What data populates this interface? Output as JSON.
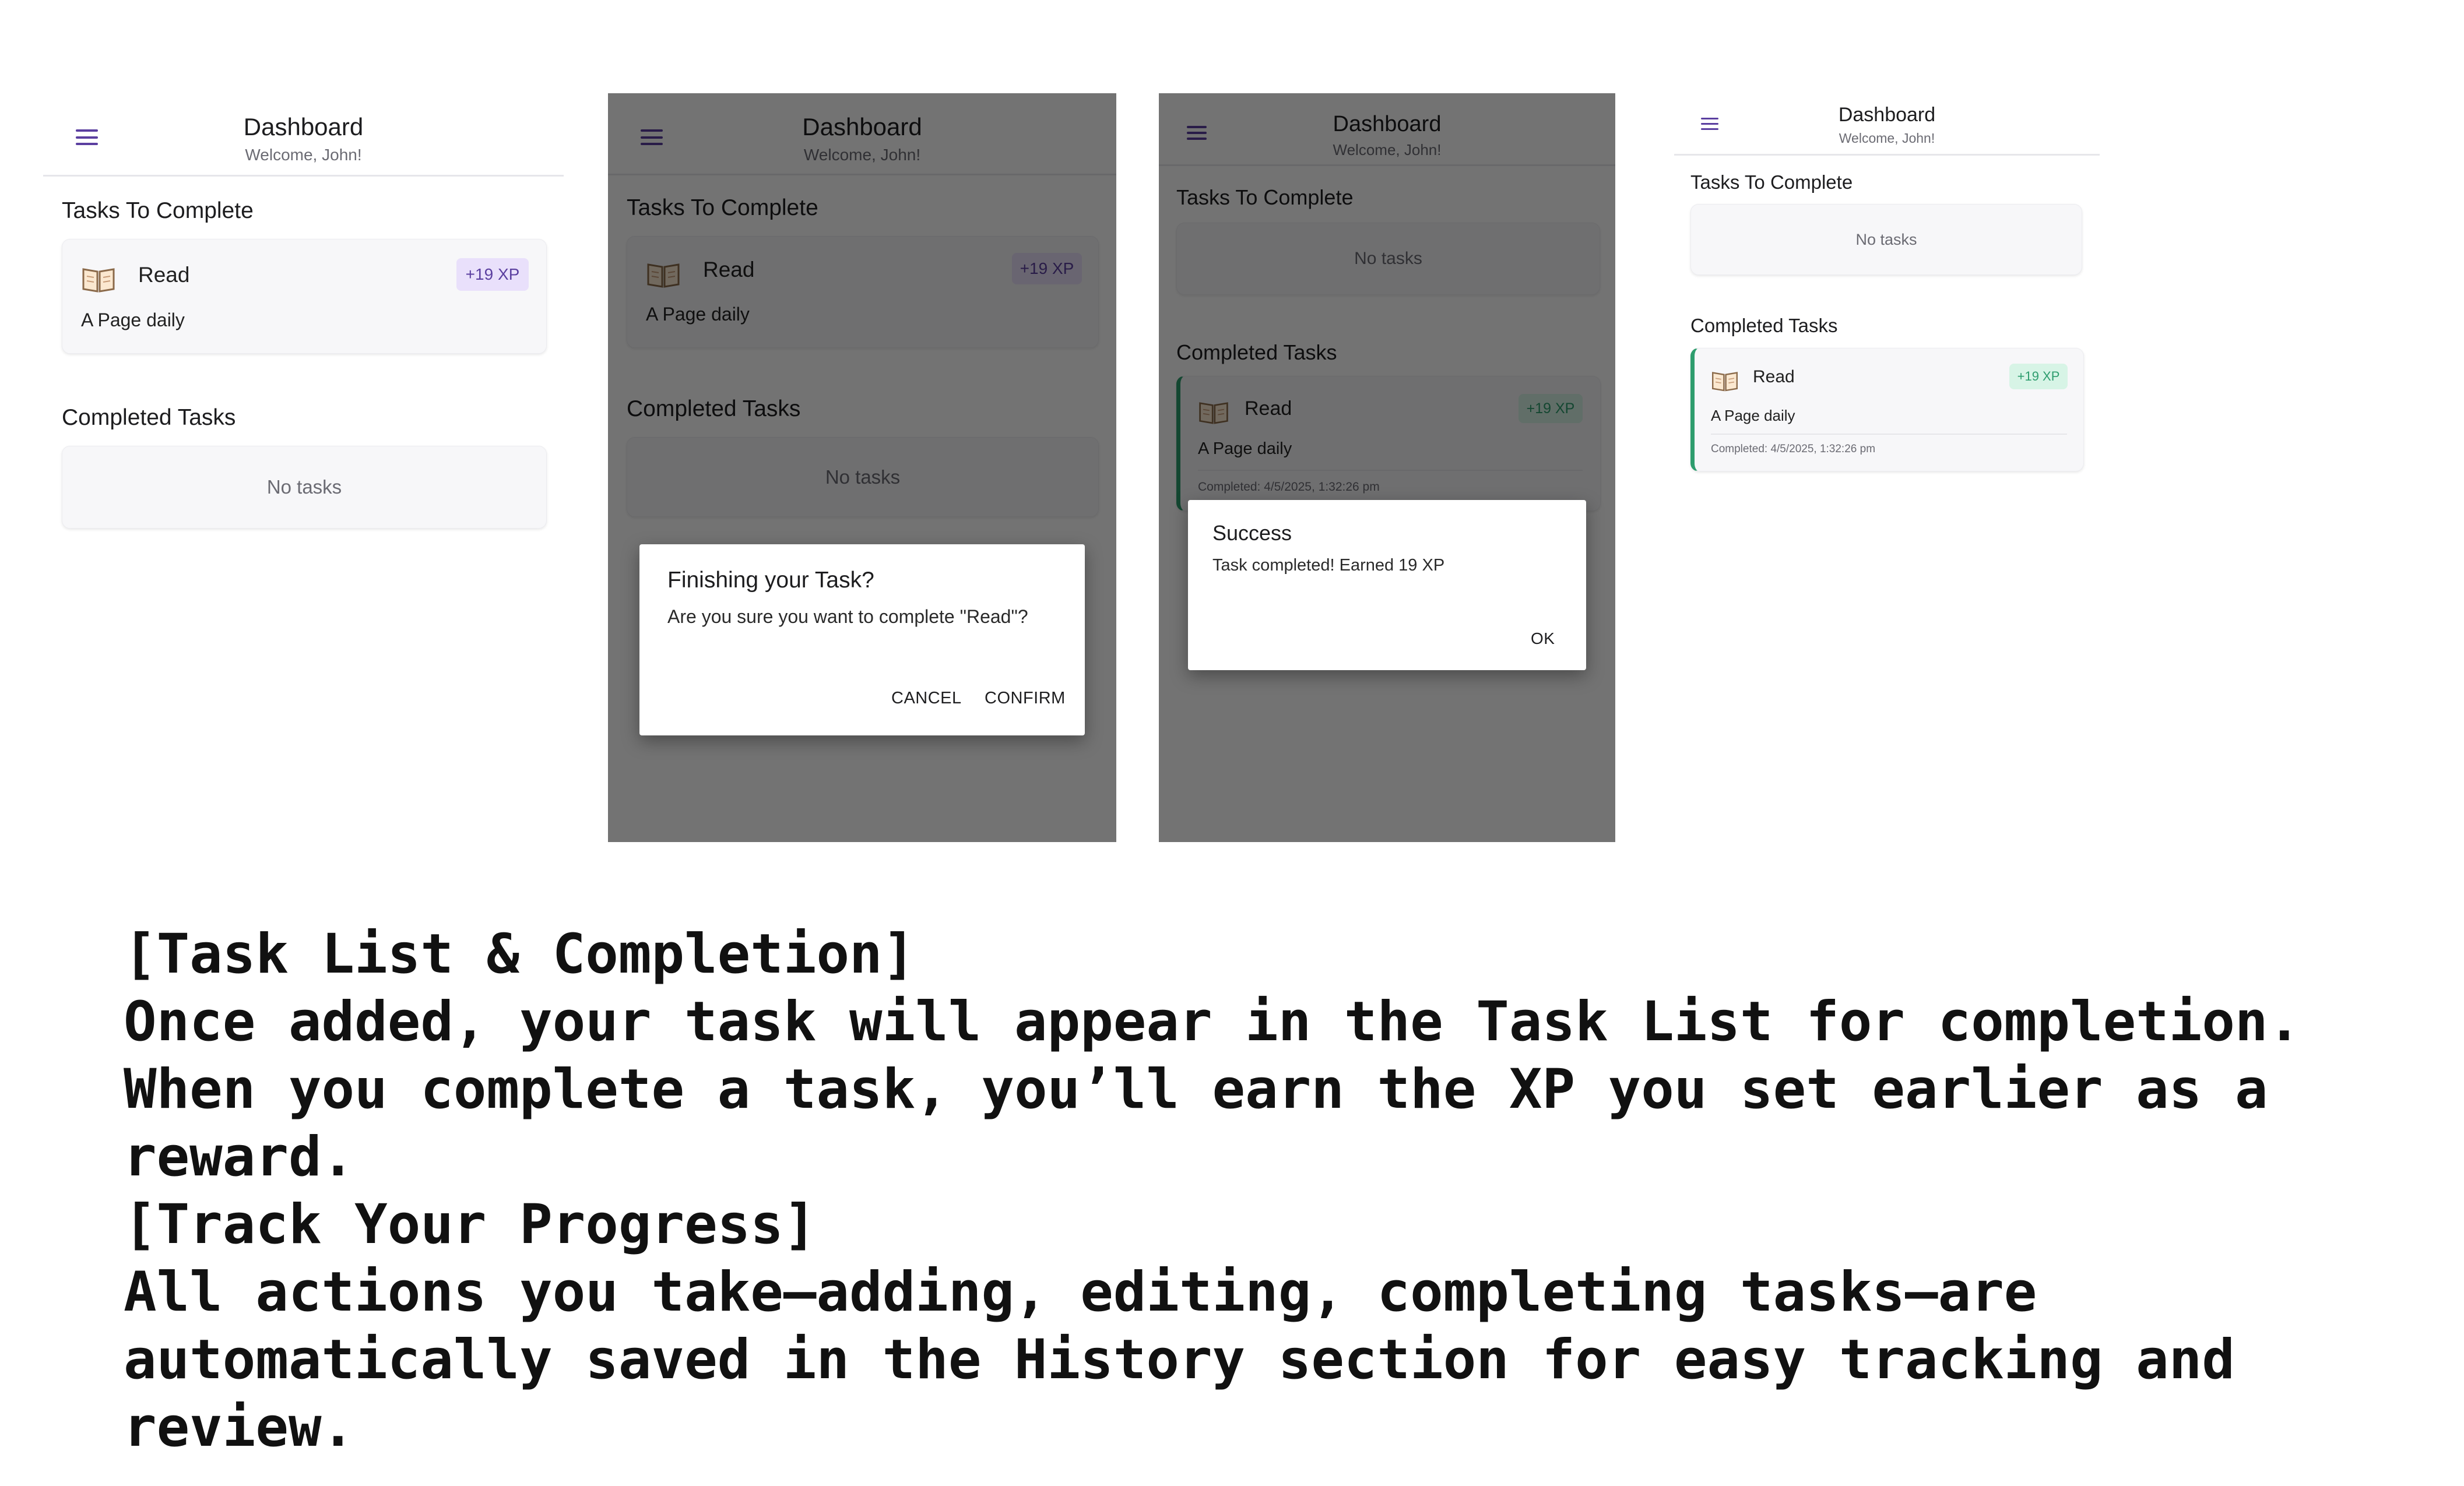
{
  "screens": {
    "dashboard_title": "Dashboard",
    "welcome_text": "Welcome, John!",
    "tasks_to_complete": "Tasks To Complete",
    "completed_tasks": "Completed Tasks",
    "no_tasks": "No tasks",
    "menu_icon": "hamburger-menu-icon",
    "task_icon": "open-book-icon"
  },
  "task": {
    "name": "Read",
    "description": "A Page daily",
    "xp_badge": "+19 XP",
    "completed_at": "Completed: 4/5/2025, 1:32:26 pm"
  },
  "confirm_dialog": {
    "title": "Finishing your Task?",
    "message": "Are you sure you want to complete \"Read\"?",
    "cancel": "CANCEL",
    "confirm": "CONFIRM"
  },
  "success_dialog": {
    "title": "Success",
    "message": "Task completed! Earned 19 XP",
    "ok": "OK"
  },
  "caption": {
    "heading1": "[Task List & Completion]",
    "p1_line1": "Once added, your task will appear in the Task List for completion.",
    "p1_line2": "When you complete a task, you’ll earn the XP you set earlier as a",
    "p1_line3": "reward.",
    "heading2": "[Track Your Progress]",
    "p2_line1": "All actions you take—adding, editing, completing tasks—are",
    "p2_line2": "automatically saved in the History section for easy tracking and",
    "p2_line3": "review."
  },
  "colors": {
    "accent": "#5b3fa0",
    "success": "#2e9d6e",
    "xp_badge_bg": "#e9e0fb",
    "xp_done_bg": "#d7f4e6"
  }
}
